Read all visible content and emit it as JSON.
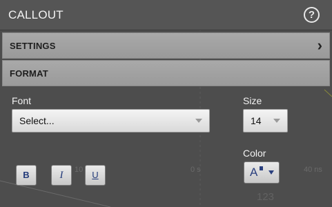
{
  "header": {
    "title": "CALLOUT",
    "help_icon": "help-circle-icon"
  },
  "sections": {
    "settings": {
      "label": "SETTINGS",
      "chevron_icon": "chevron-right-icon"
    },
    "format": {
      "label": "FORMAT"
    }
  },
  "format": {
    "font": {
      "label": "Font",
      "value": "Select..."
    },
    "size": {
      "label": "Size",
      "value": "14"
    },
    "color": {
      "label": "Color",
      "value_icon": "text-color-icon",
      "accent": "#2a3f7e"
    },
    "style_buttons": {
      "bold": "B",
      "italic": "I",
      "underline": "U"
    }
  },
  "background": {
    "axis_labels": [
      "10",
      "0 s",
      "40 ns"
    ],
    "readout": "123"
  }
}
